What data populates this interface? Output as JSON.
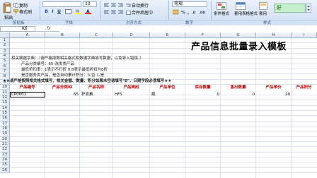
{
  "ribbon": {
    "clipboard": {
      "paste_label": "粘贴",
      "copy_label": "复制",
      "format_painter_label": "格式刷",
      "group_label": "剪贴板"
    },
    "font": {
      "font_name": "",
      "font_size": "10",
      "bold": "B",
      "italic": "I",
      "underline": "U",
      "group_label": "字体"
    },
    "alignment": {
      "wrap_label": "自动换行",
      "merge_label": "合并后居中",
      "group_label": "对齐方式"
    },
    "number": {
      "format_value": "常规",
      "group_label": "数字"
    },
    "styles": {
      "conditional_label": "条件格式",
      "table_format_label": "套用表格格式",
      "good_label": "好",
      "apply_label": "套用",
      "group_label": "样式"
    }
  },
  "formula_bar": {
    "name_box": "K6",
    "fx_label": "fx",
    "formula": ""
  },
  "columns": [
    "A",
    "B",
    "C",
    "D",
    "E",
    "F",
    "G",
    "H",
    "I"
  ],
  "rows": [
    "1",
    "2",
    "3",
    "4",
    "5",
    "6",
    "7",
    "8",
    "9",
    "10",
    "11",
    "12",
    "13",
    "14",
    "15",
    "16",
    "17",
    "18",
    "19",
    "20",
    "21",
    "22",
    "23",
    "24",
    "25",
    "26"
  ],
  "sheet": {
    "title": "产品信息批量录入模板",
    "notes": [
      "相关数据字典：（请严格按照相关格式和数据字典填写数据，以免导入错误。）",
      "产品分类编号：65-洗发类产品",
      "最低折扣率：1表示不打折  0.8表示最低折扣为8折",
      "是否服务类产品，是否自动累计积分：0-否  1-是",
      "★★请严格按照相关格式填写，相关金额、数量、积分如果未空请填写\"0\"，日期字段必须填写★★"
    ],
    "headers": [
      "产品编号",
      "产品分类ID",
      "产品名称",
      "产品简码",
      "产品单位",
      "库存数量",
      "售出数量",
      "产品单价",
      "产品积分"
    ],
    "row6": [
      "CP0001",
      "65",
      "护发素",
      "HFS",
      "瓶",
      "0",
      "0",
      "20",
      ""
    ]
  }
}
